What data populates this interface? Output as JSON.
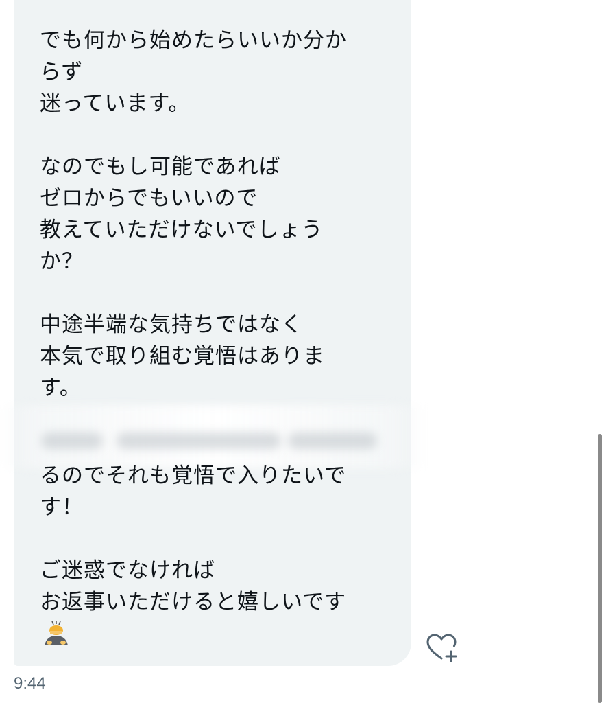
{
  "message": {
    "upper_text": "でも何から始めたらいいか分か\nらず\n迷っています。\n\nなのでもし可能であれば\nゼロからでもいいので\n教えていただけないでしょう\nか？\n\n中途半端な気持ちではなく\n本気で取り組む覚悟はありま\nす。",
    "lower_text": "るのでそれも覚悟で入りたいで\nす！\n\nご迷惑でなければ\nお返事いただけると嬉しいです",
    "emoji": "person-bowing-emoji",
    "timestamp": "9:44"
  },
  "icons": {
    "react": "heart-plus-icon"
  },
  "colors": {
    "bubble": "#eff3f4",
    "text": "#0f1419",
    "timestamp": "#536471"
  }
}
